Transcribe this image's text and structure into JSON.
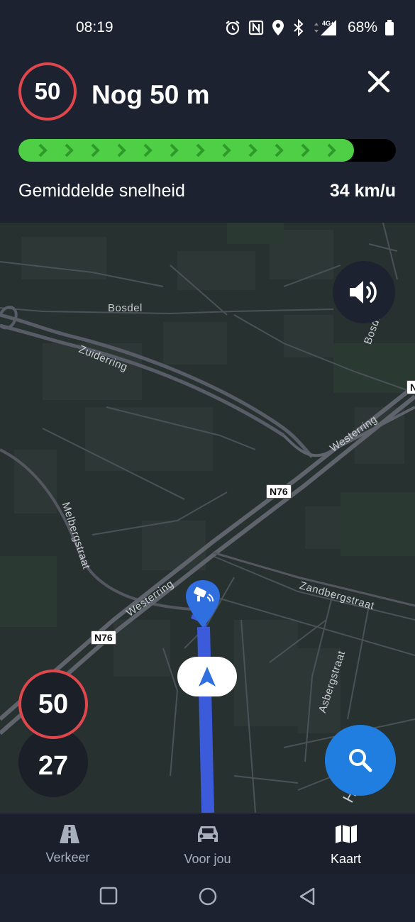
{
  "status_bar": {
    "time": "08:19",
    "network": "4G+",
    "battery": "68%",
    "icons": [
      "alarm-icon",
      "nfc-icon",
      "location-icon",
      "bluetooth-icon",
      "signal-icon",
      "battery-icon"
    ]
  },
  "navigation": {
    "speed_limit": "50",
    "distance_remaining": "Nog 50 m",
    "progress_fraction": 0.89,
    "average_speed_label": "Gemiddelde snelheid",
    "average_speed_value": "34 km/u"
  },
  "map": {
    "labels": {
      "bosdel_west": "Bosdel",
      "bosdel_east": "Bosdel",
      "zuiderring": "Zuiderring",
      "westerring_ne": "Westerring",
      "westerring_sw": "Westerring",
      "melbergstraat": "Melbergstraat",
      "zandbergstraat": "Zandbergstraat",
      "asbergstraat": "Asbergstraat",
      "partial_street": "H",
      "partial_edge": "N"
    },
    "road_shields": {
      "n76_upper": "N76",
      "n76_lower": "N76"
    },
    "speed_limit_sign": "50",
    "current_speed": "27"
  },
  "bottom_nav": {
    "tabs": [
      {
        "label": "Verkeer",
        "icon": "road-icon",
        "active": false
      },
      {
        "label": "Voor jou",
        "icon": "car-icon",
        "active": false
      },
      {
        "label": "Kaart",
        "icon": "map-icon",
        "active": true
      }
    ]
  },
  "colors": {
    "background": "#1c2230",
    "progress_green": "#4fcf45",
    "speed_red": "#e0474c",
    "route_blue": "#3b5bdb",
    "action_blue": "#1f7ee0"
  }
}
